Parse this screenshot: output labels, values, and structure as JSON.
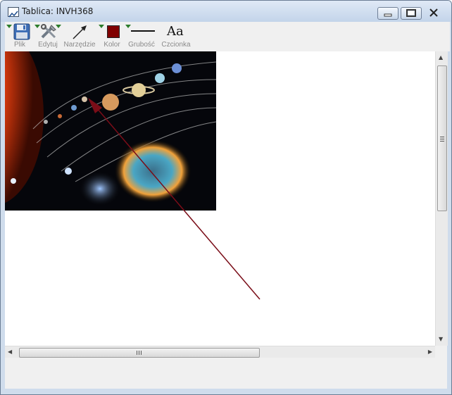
{
  "window": {
    "title": "Tablica: INVH368"
  },
  "toolbar": {
    "items": [
      {
        "label": "Plik",
        "icon": "floppy-disk-icon"
      },
      {
        "label": "Edytuj",
        "icon": "tools-icon"
      },
      {
        "label": "Narzędzie",
        "icon": "arrow-tool-icon"
      },
      {
        "label": "Kolor",
        "icon": "color-swatch-icon"
      },
      {
        "label": "Grubość",
        "icon": "line-thickness-icon"
      },
      {
        "label": "Czcionka",
        "icon": "font-icon",
        "glyph": "Aa"
      }
    ]
  },
  "colors": {
    "selected_color": "#800000",
    "arrow_color": "#7a0d18",
    "dropdown_indicator": "#2d7d2d"
  },
  "canvas": {
    "image": "solar-system-image",
    "annotation": "arrow-annotation"
  },
  "scrollbars": {
    "vertical": "vertical-scrollbar",
    "horizontal": "horizontal-scrollbar"
  }
}
